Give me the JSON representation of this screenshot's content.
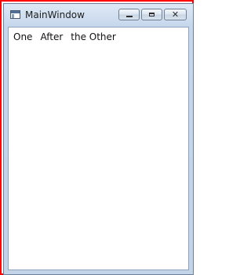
{
  "window": {
    "title": "MainWindow",
    "icon": "app-window-icon"
  },
  "controls": {
    "minimize_glyph": "—",
    "maximize_glyph": "□",
    "close_glyph": "✕"
  },
  "content": {
    "items": [
      "One",
      "After",
      "the Other"
    ]
  },
  "colors": {
    "frame_outline": "#ff0000",
    "titlebar": "#c6d7ec",
    "client_background": "#ffffff"
  }
}
